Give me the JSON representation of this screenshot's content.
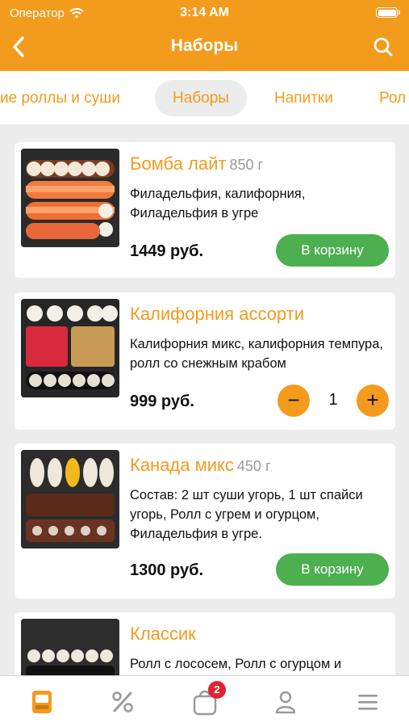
{
  "status_bar": {
    "carrier": "Оператор",
    "time": "3:14 AM"
  },
  "header": {
    "title": "Наборы",
    "back_icon": "chevron-left-icon",
    "search_icon": "search-icon",
    "color": "#f29b1d"
  },
  "tabs": [
    {
      "label": "ие роллы и суши",
      "active": false
    },
    {
      "label": "Наборы",
      "active": true
    },
    {
      "label": "Напитки",
      "active": false
    },
    {
      "label": "Рол",
      "active": false
    }
  ],
  "products": [
    {
      "title": "Бомба лайт",
      "weight": "850 г",
      "description": "Филадельфия, калифорния, Филадельфия в угре",
      "price": "1449 руб.",
      "action": "В корзину"
    },
    {
      "title": "Калифорния ассорти",
      "weight": "",
      "description": "Калифорния микс, калифорния темпура, ролл со снежным крабом",
      "price": "999 руб.",
      "stepper": {
        "minus": "−",
        "quantity": "1",
        "plus": "+"
      }
    },
    {
      "title": "Канада микс",
      "weight": "450 г",
      "description": "Состав: 2 шт суши угорь, 1 шт спайси угорь, Ролл с угрем и огурцом, Филадельфия в угре.",
      "price": "1300 руб.",
      "action": "В корзину"
    },
    {
      "title": "Классик",
      "weight": "",
      "description": "Ролл с лососем, Ролл с огурцом и",
      "price": ""
    }
  ],
  "bottom_bar": {
    "items": [
      {
        "icon": "menu-book-icon",
        "active": true
      },
      {
        "icon": "percent-icon",
        "active": false
      },
      {
        "icon": "cart-icon",
        "active": false,
        "badge": "2"
      },
      {
        "icon": "profile-icon",
        "active": false
      },
      {
        "icon": "hamburger-icon",
        "active": false
      }
    ]
  },
  "colors": {
    "accent": "#f29b1d",
    "cart_button": "#4caf50",
    "badge": "#e0242f"
  }
}
